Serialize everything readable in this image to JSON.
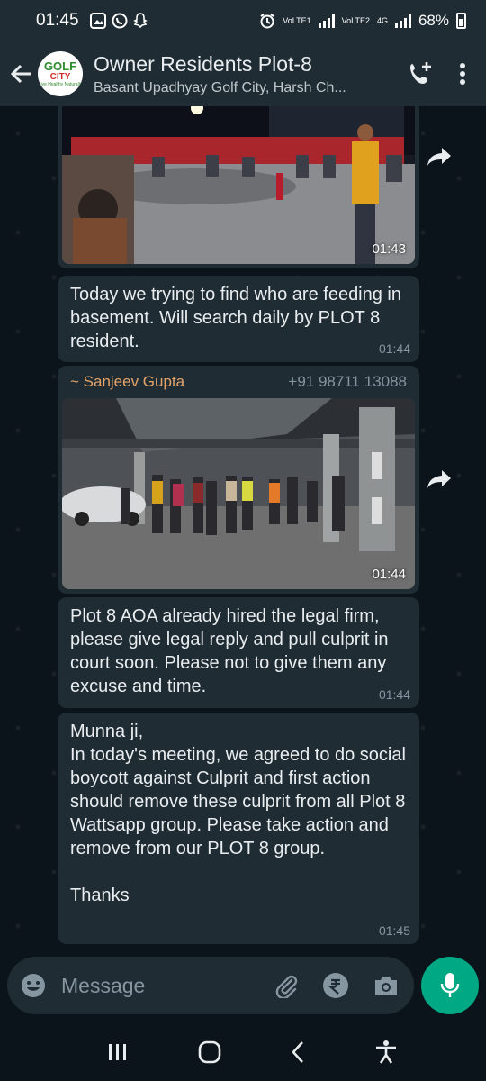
{
  "status_bar": {
    "time": "01:45",
    "sim1": "VoLTE1",
    "sim2": "VoLTE2",
    "network": "4G",
    "battery": "68%"
  },
  "header": {
    "avatar_text_1": "GOLF",
    "avatar_text_2": "CITY",
    "avatar_text_3": "Live Healthy Naturally",
    "title": "Owner Residents Plot-8",
    "subtitle": "Basant Upadhyay Golf City, Harsh Ch..."
  },
  "messages": [
    {
      "type": "image",
      "time": "01:43"
    },
    {
      "type": "text",
      "text": "Today we trying to find who are feeding in basement. Will search daily by PLOT 8 resident.",
      "time": "01:44"
    },
    {
      "type": "image",
      "sender": "~ Sanjeev Gupta",
      "phone": "+91 98711 13088",
      "time": "01:44"
    },
    {
      "type": "text",
      "text": "Plot 8 AOA already hired the legal firm, please give legal reply and pull culprit in court soon. Please not to give them any excuse and time.",
      "time": "01:44"
    },
    {
      "type": "text",
      "text": "Munna ji,\nIn today's meeting, we agreed to do social boycott against Culprit and first action should remove these culprit from all Plot 8 Wattsapp group. Please take action and remove from our PLOT 8 group.\n\nThanks",
      "time": "01:45"
    }
  ],
  "composer": {
    "placeholder": "Message"
  },
  "colors": {
    "background": "#0b141a",
    "bubble": "#1f2c34",
    "accent": "#00a884",
    "sender": "#e5a46a"
  }
}
